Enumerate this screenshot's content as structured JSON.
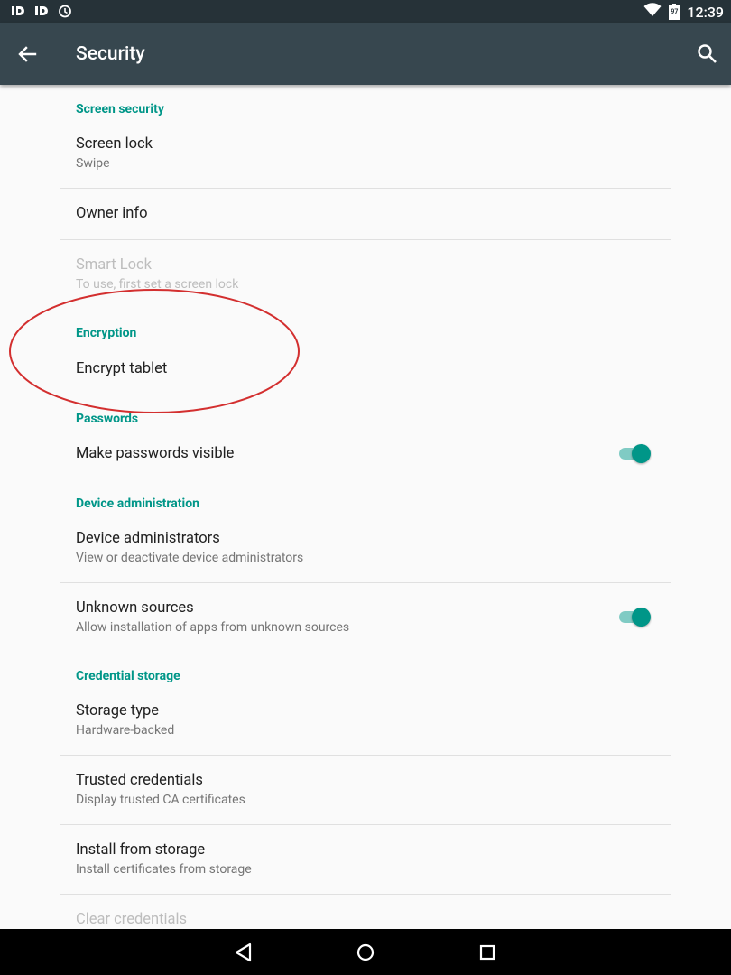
{
  "status_bar": {
    "time": "12:39",
    "battery_level": "97",
    "left_icons": [
      "id-card-icon",
      "id-card-icon",
      "alarm-icon"
    ],
    "right_icons": [
      "wifi-icon",
      "battery-icon"
    ]
  },
  "app_bar": {
    "title": "Security",
    "background": "#37474f"
  },
  "accent_color": "#009688",
  "sections": {
    "screen_security": {
      "header": "Screen security",
      "screen_lock": {
        "title": "Screen lock",
        "subtitle": "Swipe"
      },
      "owner_info": {
        "title": "Owner info"
      },
      "smart_lock": {
        "title": "Smart Lock",
        "subtitle": "To use, first set a screen lock",
        "enabled": false
      }
    },
    "encryption": {
      "header": "Encryption",
      "encrypt_tablet": {
        "title": "Encrypt tablet"
      }
    },
    "passwords": {
      "header": "Passwords",
      "make_passwords_visible": {
        "title": "Make passwords visible",
        "toggle_on": true
      }
    },
    "device_administration": {
      "header": "Device administration",
      "device_administrators": {
        "title": "Device administrators",
        "subtitle": "View or deactivate device administrators"
      },
      "unknown_sources": {
        "title": "Unknown sources",
        "subtitle": "Allow installation of apps from unknown sources",
        "toggle_on": true
      }
    },
    "credential_storage": {
      "header": "Credential storage",
      "storage_type": {
        "title": "Storage type",
        "subtitle": "Hardware-backed"
      },
      "trusted_credentials": {
        "title": "Trusted credentials",
        "subtitle": "Display trusted CA certificates"
      },
      "install_from_storage": {
        "title": "Install from storage",
        "subtitle": "Install certificates from storage"
      },
      "clear_credentials": {
        "title": "Clear credentials",
        "enabled": false
      }
    }
  },
  "annotation": {
    "shape": "ellipse",
    "color": "#d32f2f",
    "highlights": "Encryption"
  },
  "nav_bar": {
    "buttons": [
      "back-triangle-icon",
      "home-circle-icon",
      "recents-square-icon"
    ]
  }
}
